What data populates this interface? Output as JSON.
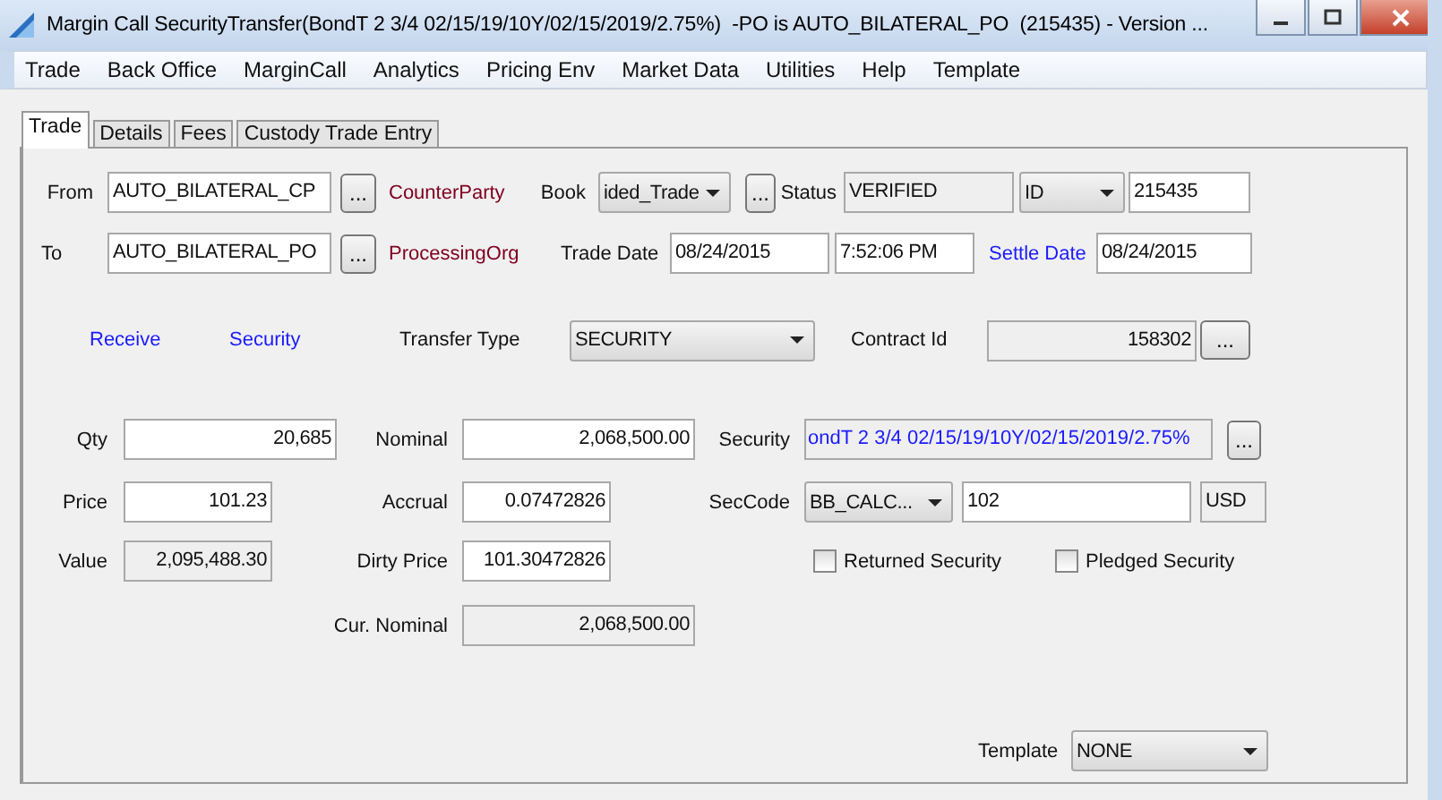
{
  "window": {
    "title": "Margin Call SecurityTransfer(BondT 2 3/4 02/15/19/10Y/02/15/2019/2.75%)  -PO is AUTO_BILATERAL_PO  (215435) - Version ..."
  },
  "menu": [
    "Trade",
    "Back Office",
    "MarginCall",
    "Analytics",
    "Pricing Env",
    "Market Data",
    "Utilities",
    "Help",
    "Template"
  ],
  "tabs": [
    {
      "label": "Trade",
      "selected": true
    },
    {
      "label": "Details",
      "selected": false
    },
    {
      "label": "Fees",
      "selected": false
    },
    {
      "label": "Custody Trade Entry",
      "selected": false
    }
  ],
  "from": {
    "label": "From",
    "value": "AUTO_BILATERAL_CP",
    "button": "...",
    "role": "CounterParty"
  },
  "to": {
    "label": "To",
    "value": "AUTO_BILATERAL_PO",
    "button": "...",
    "role": "ProcessingOrg"
  },
  "book": {
    "label": "Book",
    "value": "ided_Trade",
    "button": "..."
  },
  "status": {
    "label": "Status",
    "value": "VERIFIED",
    "disabled": true
  },
  "id_type": {
    "value": "ID"
  },
  "id": {
    "value": "215435",
    "disabled": false
  },
  "trade_date": {
    "label": "Trade Date",
    "date": "08/24/2015",
    "time": "7:52:06 PM"
  },
  "settle_date": {
    "label": "Settle Date",
    "value": "08/24/2015"
  },
  "links": [
    "Receive",
    "Security"
  ],
  "transfer_type": {
    "label": "Transfer Type",
    "value": "SECURITY"
  },
  "contract_id": {
    "label": "Contract Id",
    "value": "158302",
    "disabled": true,
    "button": "..."
  },
  "qty": {
    "label": "Qty",
    "value": "20,685",
    "disabled": false
  },
  "nominal": {
    "label": "Nominal",
    "value": "2,068,500.00",
    "disabled": false
  },
  "security": {
    "label": "Security",
    "value": "ondT 2 3/4 02/15/19/10Y/02/15/2019/2.75%",
    "disabled": true,
    "button": "..."
  },
  "price": {
    "label": "Price",
    "value": "101.23",
    "disabled": false
  },
  "accrual": {
    "label": "Accrual",
    "value": "0.07472826",
    "disabled": false
  },
  "sec_code": {
    "label": "SecCode",
    "type": "BB_CALC...",
    "value": "102",
    "currency": "USD"
  },
  "value": {
    "label": "Value",
    "value": "2,095,488.30",
    "disabled": true
  },
  "dirty_price": {
    "label": "Dirty Price",
    "value": "101.30472826",
    "disabled": false
  },
  "checkboxes": [
    {
      "label": "Returned Security",
      "checked": false
    },
    {
      "label": "Pledged Security",
      "checked": false
    }
  ],
  "cur_nominal": {
    "label": "Cur. Nominal",
    "value": "2,068,500.00",
    "disabled": true
  },
  "template": {
    "label": "Template",
    "value": "NONE"
  }
}
